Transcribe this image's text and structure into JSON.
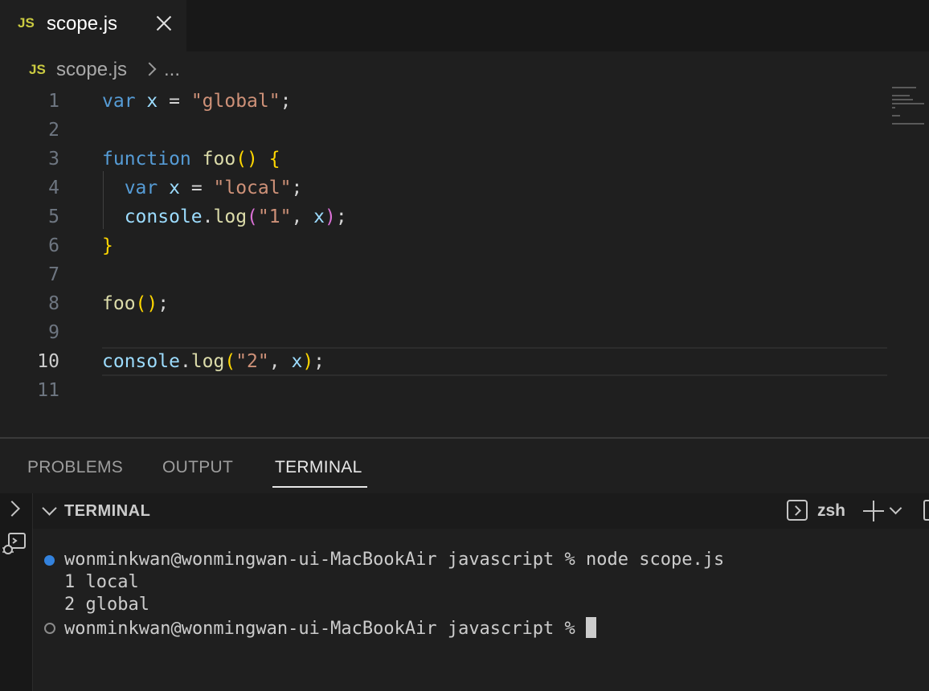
{
  "tab": {
    "badge": "JS",
    "title": "scope.js"
  },
  "breadcrumb": {
    "badge": "JS",
    "file": "scope.js",
    "more": "..."
  },
  "editor": {
    "line_numbers": [
      "1",
      "2",
      "3",
      "4",
      "5",
      "6",
      "7",
      "8",
      "9",
      "10",
      "11"
    ],
    "active_line": "10"
  },
  "panel": {
    "tabs": [
      "PROBLEMS",
      "OUTPUT",
      "TERMINAL"
    ],
    "active_tab": "TERMINAL",
    "terminal_title": "TERMINAL",
    "shell": "zsh"
  },
  "terminal": {
    "prompt": "wonminkwan@wonmingwan-ui-MacBookAir javascript %",
    "command": "node scope.js",
    "output": [
      "1 local",
      "2 global"
    ]
  },
  "colors": {
    "keyword": "#569cd6",
    "variable": "#9cdcfe",
    "string": "#ce9178",
    "function": "#dcdcaa",
    "bracket": "#ffd700",
    "js_badge": "#cbcb41",
    "success_dot": "#3794ff"
  },
  "icons": {
    "tab_close": "close-icon",
    "breadcrumb_separator": "chevron-right-icon",
    "shell": "terminal-icon",
    "new_terminal": "plus-icon",
    "dropdown": "chevron-down-icon"
  }
}
